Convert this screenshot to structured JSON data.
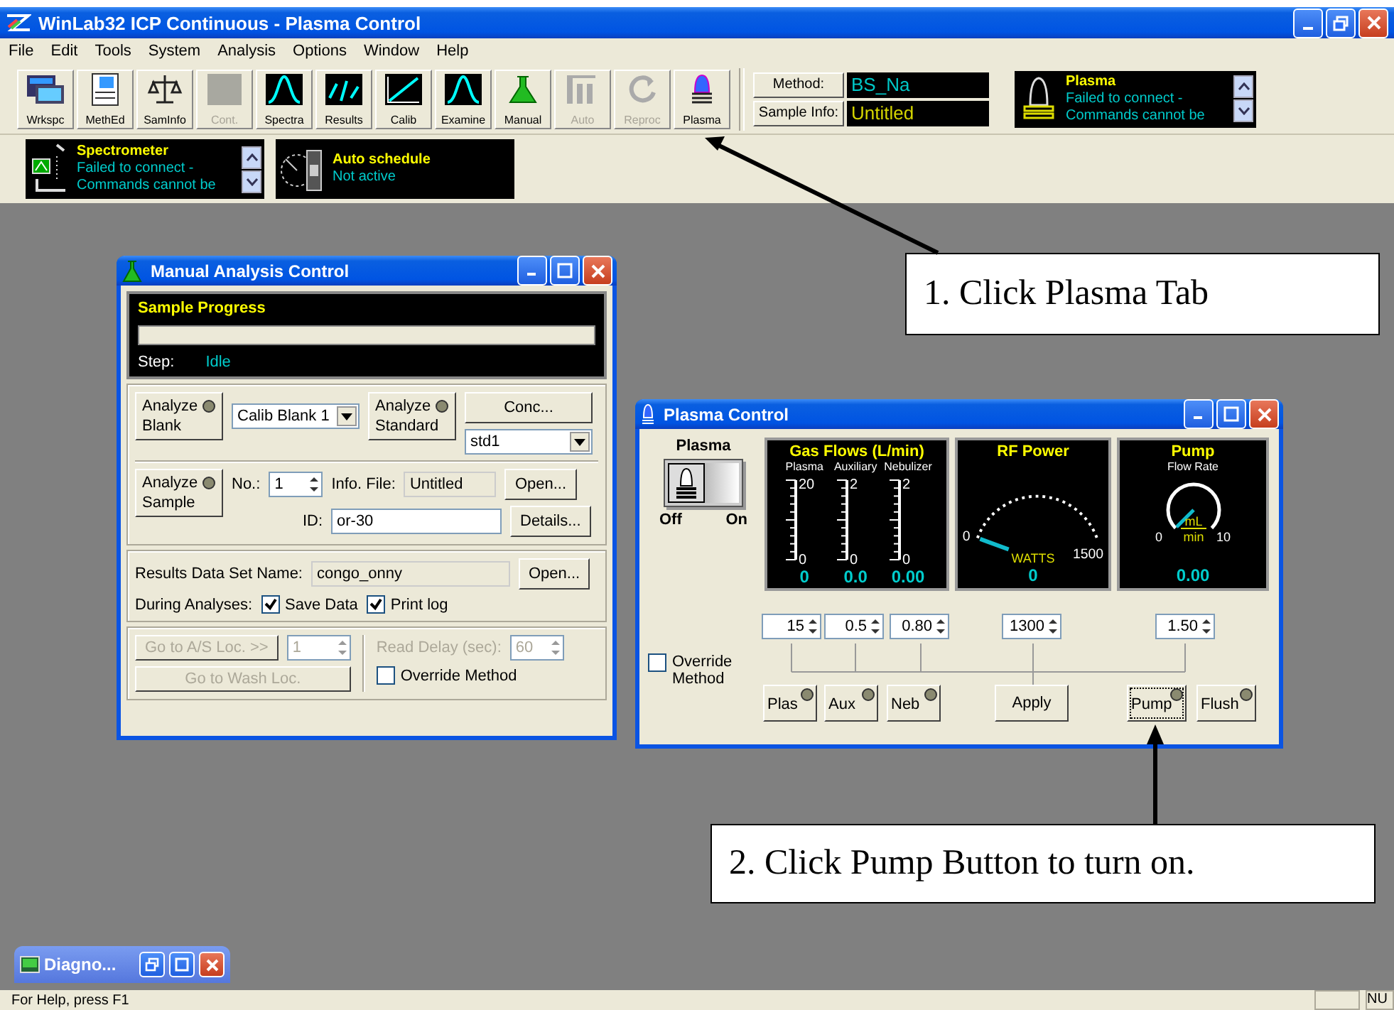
{
  "window": {
    "title": "WinLab32 ICP Continuous - Plasma Control"
  },
  "menu": [
    "File",
    "Edit",
    "Tools",
    "System",
    "Analysis",
    "Options",
    "Window",
    "Help"
  ],
  "toolbar": [
    {
      "label": "Wrkspc",
      "disabled": false
    },
    {
      "label": "MethEd",
      "disabled": false
    },
    {
      "label": "SamInfo",
      "disabled": false
    },
    {
      "label": "Cont.",
      "disabled": true
    },
    {
      "label": "Spectra",
      "disabled": false
    },
    {
      "label": "Results",
      "disabled": false
    },
    {
      "label": "Calib",
      "disabled": false
    },
    {
      "label": "Examine",
      "disabled": false
    },
    {
      "label": "Manual",
      "disabled": false
    },
    {
      "label": "Auto",
      "disabled": true
    },
    {
      "label": "Reproc",
      "disabled": true
    },
    {
      "label": "Plasma",
      "disabled": false
    }
  ],
  "method_fields": [
    {
      "label": "Method:",
      "value": "BS_Na"
    },
    {
      "label": "Sample Info:",
      "value": "Untitled"
    }
  ],
  "status_panels": [
    {
      "kind": "plasma",
      "title": "Plasma",
      "lines": [
        "Failed to connect -",
        "Commands cannot be"
      ]
    },
    {
      "kind": "spectrometer",
      "title": "Spectrometer",
      "lines": [
        "Failed to connect -",
        "Commands cannot be"
      ]
    },
    {
      "kind": "schedule",
      "title": "Auto schedule",
      "lines": [
        "Not active"
      ]
    }
  ],
  "manual_window": {
    "title": "Manual Analysis Control",
    "progress": {
      "title": "Sample Progress",
      "level": 0,
      "step_label": "Step:",
      "step": "Idle"
    },
    "blank_button": "Analyze Blank",
    "blank_choice": "Calib Blank 1",
    "standard_button": "Analyze Standard",
    "conc_button": "Conc...",
    "standard_choice": "std1",
    "sample_button": "Analyze Sample",
    "no_label": "No.:",
    "no_value": "1",
    "info_label": "Info. File:",
    "info_value": "Untitled",
    "info_open": "Open...",
    "id_label": "ID:",
    "id_value": "or-30",
    "details_button": "Details...",
    "results_label": "Results Data Set Name:",
    "results_value": "congo_onny",
    "results_open": "Open...",
    "during_label": "During Analyses:",
    "during_options": [
      {
        "label": "Save Data",
        "checked": true
      },
      {
        "label": "Print log",
        "checked": true
      }
    ],
    "goto_as": {
      "label": "Go to A/S Loc. >>",
      "value": "1",
      "disabled": true
    },
    "read_delay": {
      "label": "Read Delay (sec):",
      "value": "60",
      "disabled": true
    },
    "goto_wash": {
      "label": "Go to Wash Loc.",
      "disabled": true
    },
    "override": {
      "label": "Override Method",
      "checked": false
    }
  },
  "plasma_window": {
    "title": "Plasma Control",
    "switch": {
      "title": "Plasma",
      "off_label": "Off",
      "on_label": "On",
      "on": false
    },
    "gas_flows": {
      "title": "Gas Flows (L/min)",
      "channels": [
        {
          "name": "Plasma",
          "max": "20",
          "min": "0",
          "reading": "0"
        },
        {
          "name": "Auxiliary",
          "max": "2",
          "min": "0",
          "reading": "0.0"
        },
        {
          "name": "Nebulizer",
          "max": "2",
          "min": "0",
          "reading": "0.00"
        }
      ]
    },
    "rf_power": {
      "title": "RF Power",
      "min": "0",
      "max": "1500",
      "unit": "WATTS",
      "reading": "0"
    },
    "pump": {
      "title": "Pump",
      "subtitle": "Flow Rate",
      "min": "0",
      "max": "10",
      "unit_top": "mL",
      "unit_bottom": "min",
      "reading": "0.00"
    },
    "override": {
      "label": "Override Method",
      "checked": false
    },
    "setpoints": [
      "15",
      "0.5",
      "0.80",
      "1300",
      "1.50"
    ],
    "buttons": [
      {
        "label": "Plas",
        "lamp": true,
        "focused": false
      },
      {
        "label": "Aux",
        "lamp": true,
        "focused": false
      },
      {
        "label": "Neb",
        "lamp": true,
        "focused": false
      },
      {
        "label": "Apply",
        "lamp": false,
        "focused": false
      },
      {
        "label": "Pump",
        "lamp": true,
        "focused": true
      },
      {
        "label": "Flush",
        "lamp": true,
        "focused": false
      }
    ]
  },
  "minimized_window": {
    "title": "Diagno..."
  },
  "status_bar": {
    "text": "For Help, press F1",
    "indicator": "NU"
  },
  "callouts": [
    {
      "text": "1. Click Plasma Tab"
    },
    {
      "text": "2. Click Pump Button to turn on."
    }
  ]
}
